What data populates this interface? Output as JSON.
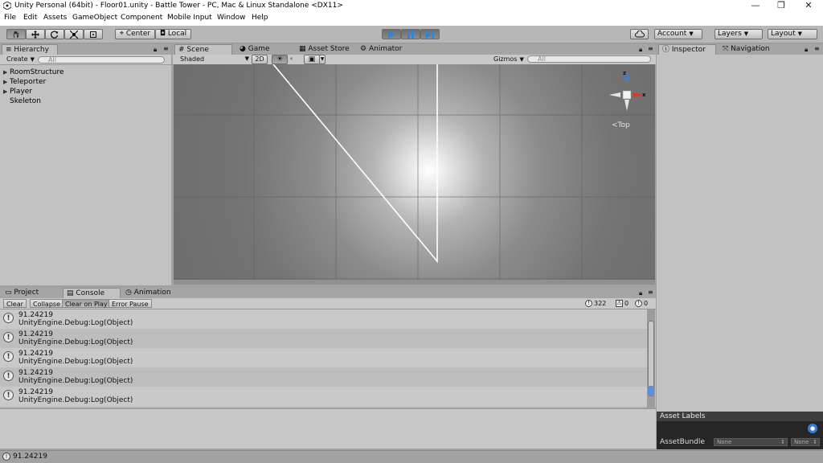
{
  "window": {
    "title": "Unity Personal (64bit) - Floor01.unity - Battle Tower - PC, Mac & Linux Standalone <DX11>",
    "controls": [
      "—",
      "❐",
      "✕"
    ]
  },
  "menu": [
    "File",
    "Edit",
    "Assets",
    "GameObject",
    "Component",
    "Mobile Input",
    "Window",
    "Help"
  ],
  "toolbar": {
    "tools": [
      "hand-icon",
      "move-icon",
      "rotate-icon",
      "scale-icon",
      "rect-icon"
    ],
    "pivot_label": "Center",
    "space_label": "Local",
    "playback": [
      "play-icon",
      "pause-icon",
      "step-icon"
    ],
    "account_label": "Account",
    "layers_label": "Layers",
    "layout_label": "Layout"
  },
  "hierarchy": {
    "tab_label": "Hierarchy",
    "create_label": "Create",
    "search_placeholder": "All",
    "items": [
      {
        "label": "RoomStructure",
        "expandable": true
      },
      {
        "label": "Teleporter",
        "expandable": true
      },
      {
        "label": "Player",
        "expandable": true
      },
      {
        "label": "Skeleton",
        "expandable": false
      }
    ]
  },
  "scene_view": {
    "tabs": [
      "Scene",
      "Game",
      "Asset Store",
      "Animator"
    ],
    "shading_label": "Shaded",
    "mode_2d_label": "2D",
    "gizmos_label": "Gizmos",
    "search_placeholder": "All",
    "gizmo_axis_z": "z",
    "gizmo_axis_x": "x",
    "view_label": "Top"
  },
  "inspector": {
    "tabs": [
      "Inspector",
      "Navigation"
    ],
    "asset_labels_title": "Asset Labels",
    "asset_bundle_label": "AssetBundle",
    "asset_bundle_value": "None",
    "asset_variant_value": "None"
  },
  "console": {
    "tabs": [
      "Project",
      "Console",
      "Animation"
    ],
    "buttons": [
      "Clear",
      "Collapse",
      "Clear on Play",
      "Error Pause"
    ],
    "log_count": "322",
    "warn_count": "0",
    "error_count": "0",
    "entries": [
      {
        "line1": "91.24219",
        "line2": "UnityEngine.Debug:Log(Object)"
      },
      {
        "line1": "91.24219",
        "line2": "UnityEngine.Debug:Log(Object)"
      },
      {
        "line1": "91.24219",
        "line2": "UnityEngine.Debug:Log(Object)"
      },
      {
        "line1": "91.24219",
        "line2": "UnityEngine.Debug:Log(Object)"
      },
      {
        "line1": "91.24219",
        "line2": "UnityEngine.Debug:Log(Object)"
      }
    ]
  },
  "status_bar": {
    "message": "91.24219"
  }
}
